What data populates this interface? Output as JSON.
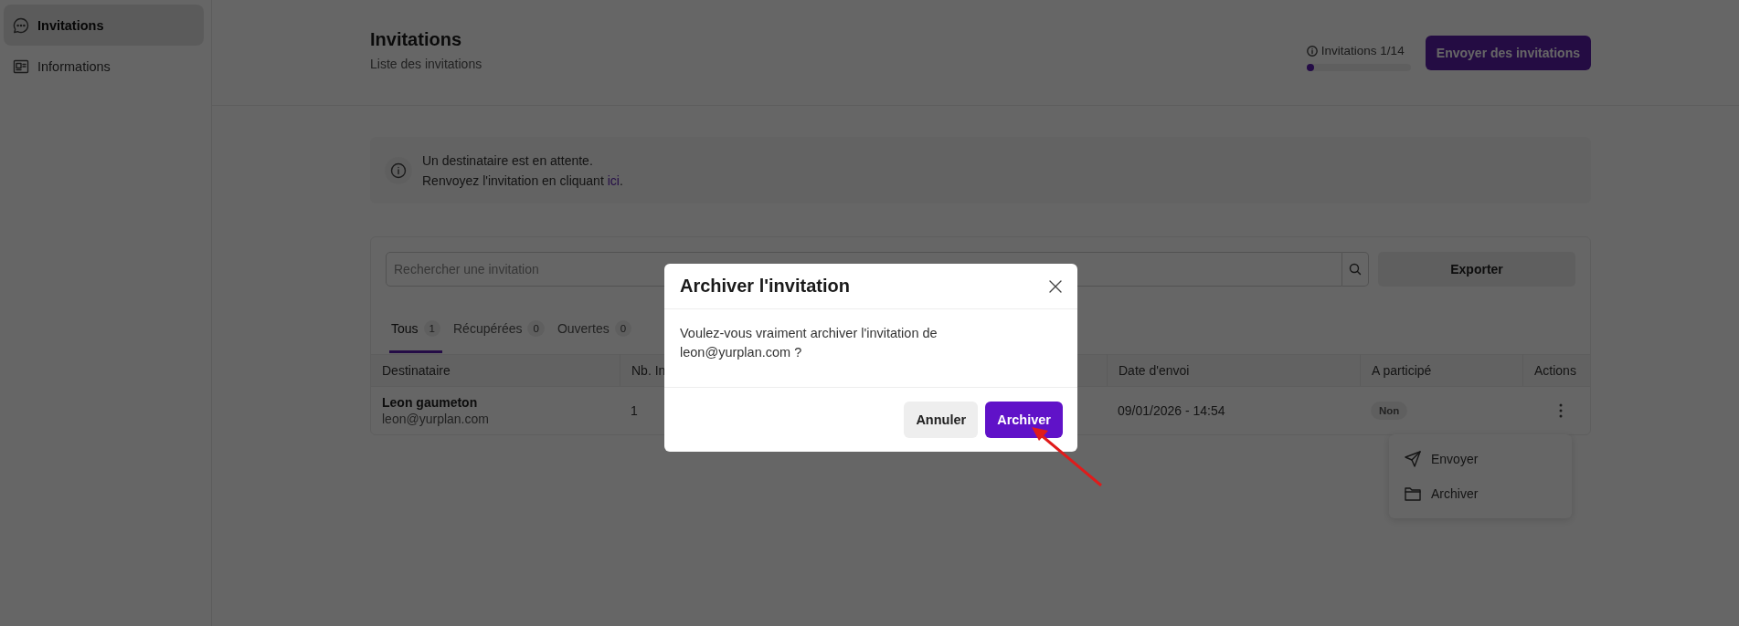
{
  "sidebar": {
    "items": [
      {
        "label": "Invitations",
        "selected": true
      },
      {
        "label": "Informations",
        "selected": false
      }
    ]
  },
  "header": {
    "title": "Invitations",
    "subtitle": "Liste des invitations",
    "quota": {
      "label": "Invitations 1/14",
      "level": 0.07
    },
    "send_button": "Envoyer des invitations"
  },
  "notice": {
    "line_1": "Un destinataire est en attente.",
    "line_2": "Renvoyez l'invitation en cliquant ",
    "link": "ici",
    "line_2_end": "."
  },
  "search": {
    "placeholder": "Rechercher une invitation"
  },
  "export_button": "Exporter",
  "tabs": [
    {
      "label": "Tous",
      "count": "1",
      "selected": true
    },
    {
      "label": "Récupérées",
      "count": "0",
      "selected": false
    },
    {
      "label": "Ouvertes",
      "count": "0",
      "selected": false
    }
  ],
  "table": {
    "columns": [
      "Destinataire",
      "Nb. In",
      "Date d'envoi",
      "A participé",
      "Actions"
    ],
    "rows": [
      {
        "name": "Leon gaumeton",
        "email": "leon@yurplan.com",
        "count": "1",
        "date": "09/01/2026 - 14:54",
        "participated": "Non"
      }
    ]
  },
  "row_menu": {
    "items": [
      {
        "label": "Envoyer"
      },
      {
        "label": "Archiver"
      }
    ]
  },
  "dialog": {
    "title": "Archiver l'invitation",
    "message": "Voulez-vous vraiment archiver l'invitation de leon@yurplan.com ?",
    "buttons": [
      {
        "label": "Annuler",
        "kind": "secondary"
      },
      {
        "label": "Archiver",
        "kind": "primary"
      }
    ]
  }
}
